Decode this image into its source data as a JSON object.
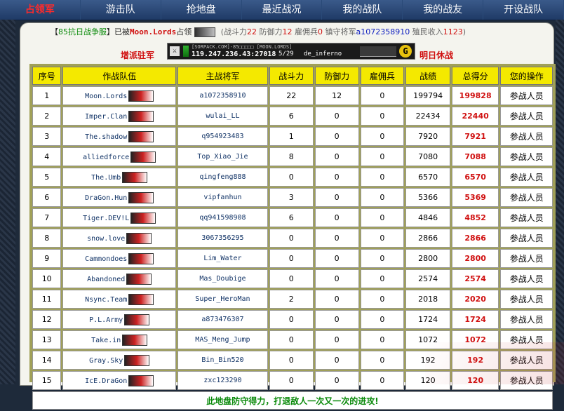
{
  "nav": {
    "items": [
      "占领军",
      "游击队",
      "抢地盘",
      "最近战况",
      "我的战队",
      "我的战友",
      "开设战队"
    ],
    "active_index": 0
  },
  "info": {
    "prefix": "【",
    "server_name": "85抗日战争服",
    "suffix": "】已被",
    "occupier": "Moon.Lords",
    "occupied_text": "占领",
    "stats_open": "(战斗力",
    "combat": "22",
    "defense_label": "防御力",
    "defense": "12",
    "merc_label": "雇佣兵",
    "merc": "0",
    "general_label": "镇守将军",
    "general": "a1072358910",
    "income_label": "殖民收入",
    "income": "1123",
    "stats_close": ")"
  },
  "actions": {
    "left": "增派驻军",
    "right": "明日休战"
  },
  "server_banner": {
    "cs_icon": "cs-icon",
    "tag": "[SORPACK.COM]-85□□□□□ [MOON.LORDS]",
    "ip": "119.247.236.43:27018",
    "players": "5/29",
    "map": "de_inferno",
    "gs_label": "G"
  },
  "table": {
    "headers": [
      "序号",
      "作战队伍",
      "主战将军",
      "战斗力",
      "防御力",
      "雇佣兵",
      "战绩",
      "总得分",
      "您的操作"
    ],
    "rows": [
      {
        "no": "1",
        "team": "Moon.Lords",
        "leader": "a1072358910",
        "combat": "22",
        "defense": "12",
        "merc": "0",
        "record": "199794",
        "score": "199828",
        "op": "参战人员"
      },
      {
        "no": "2",
        "team": "Imper.Clan",
        "leader": "wulai_LL",
        "combat": "6",
        "defense": "0",
        "merc": "0",
        "record": "22434",
        "score": "22440",
        "op": "参战人员"
      },
      {
        "no": "3",
        "team": "The.shadow",
        "leader": "q954923483",
        "combat": "1",
        "defense": "0",
        "merc": "0",
        "record": "7920",
        "score": "7921",
        "op": "参战人员"
      },
      {
        "no": "4",
        "team": "alliedforce",
        "leader": "Top_Xiao_Jie",
        "combat": "8",
        "defense": "0",
        "merc": "0",
        "record": "7080",
        "score": "7088",
        "op": "参战人员"
      },
      {
        "no": "5",
        "team": "The.Umb",
        "leader": "qingfeng888",
        "combat": "0",
        "defense": "0",
        "merc": "0",
        "record": "6570",
        "score": "6570",
        "op": "参战人员"
      },
      {
        "no": "6",
        "team": "DraGon.Hun",
        "leader": "vipfanhun",
        "combat": "3",
        "defense": "0",
        "merc": "0",
        "record": "5366",
        "score": "5369",
        "op": "参战人员"
      },
      {
        "no": "7",
        "team": "Tiger.DEV!L",
        "leader": "qq941598908",
        "combat": "6",
        "defense": "0",
        "merc": "0",
        "record": "4846",
        "score": "4852",
        "op": "参战人员"
      },
      {
        "no": "8",
        "team": "snow.love",
        "leader": "3067356295",
        "combat": "0",
        "defense": "0",
        "merc": "0",
        "record": "2866",
        "score": "2866",
        "op": "参战人员"
      },
      {
        "no": "9",
        "team": "Cammondoes",
        "leader": "Lim_Water",
        "combat": "0",
        "defense": "0",
        "merc": "0",
        "record": "2800",
        "score": "2800",
        "op": "参战人员"
      },
      {
        "no": "10",
        "team": "Abandoned",
        "leader": "Mas_Doubige",
        "combat": "0",
        "defense": "0",
        "merc": "0",
        "record": "2574",
        "score": "2574",
        "op": "参战人员"
      },
      {
        "no": "11",
        "team": "Nsync.Team",
        "leader": "Super_HeroMan",
        "combat": "2",
        "defense": "0",
        "merc": "0",
        "record": "2018",
        "score": "2020",
        "op": "参战人员"
      },
      {
        "no": "12",
        "team": "P.L.Army",
        "leader": "a873476307",
        "combat": "0",
        "defense": "0",
        "merc": "0",
        "record": "1724",
        "score": "1724",
        "op": "参战人员"
      },
      {
        "no": "13",
        "team": "Take.in",
        "leader": "MAS_Meng_Jump",
        "combat": "0",
        "defense": "0",
        "merc": "0",
        "record": "1072",
        "score": "1072",
        "op": "参战人员"
      },
      {
        "no": "14",
        "team": "Gray.Sky",
        "leader": "Bin_Bin520",
        "combat": "0",
        "defense": "0",
        "merc": "0",
        "record": "192",
        "score": "192",
        "op": "参战人员"
      },
      {
        "no": "15",
        "team": "IcE.DraGon",
        "leader": "zxc123290",
        "combat": "0",
        "defense": "0",
        "merc": "0",
        "record": "120",
        "score": "120",
        "op": "参战人员"
      }
    ],
    "footer": "此地盘防守得力，打退敌人一次又一次的进攻!"
  }
}
